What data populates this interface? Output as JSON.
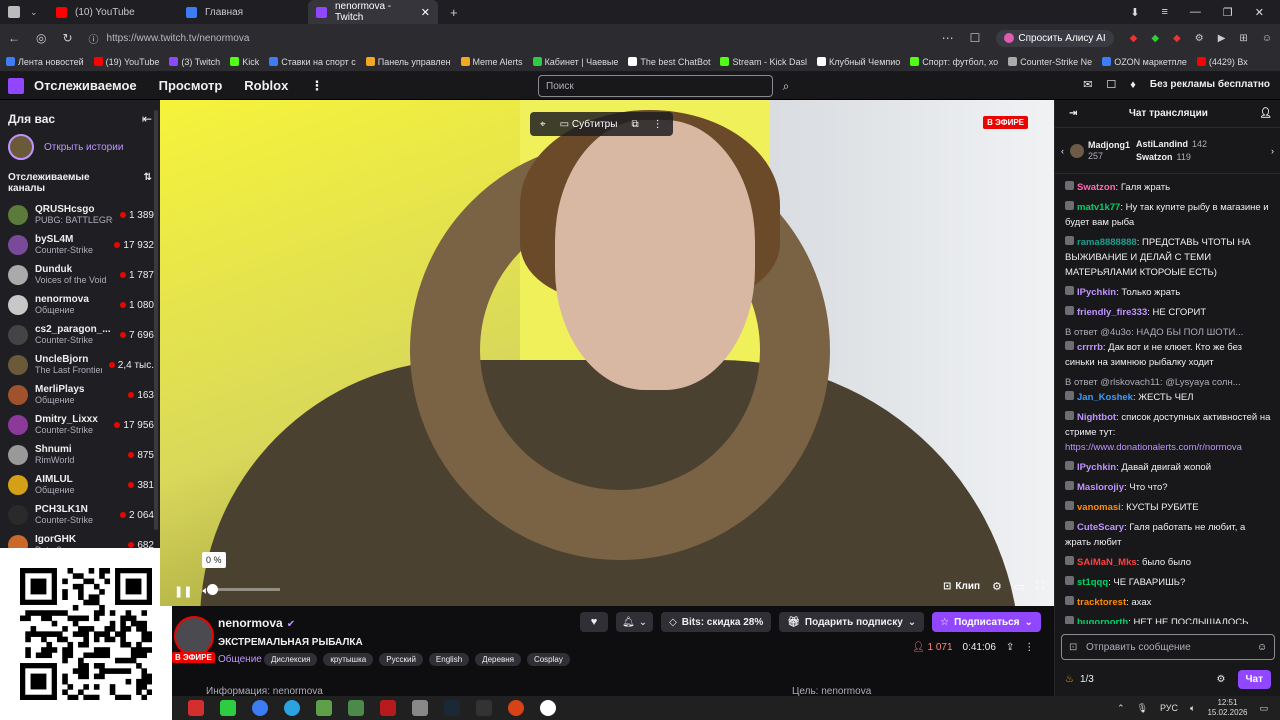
{
  "browser": {
    "tabs": [
      {
        "label": "(10) YouTube",
        "color": "#ff0000"
      },
      {
        "label": "Главная",
        "color": "#3d7cf5"
      },
      {
        "label": "nenormova - Twitch",
        "color": "#9147ff",
        "active": true
      }
    ],
    "url": "https://www.twitch.tv/nenormova",
    "ask_alice": "Спросить Алису AI"
  },
  "bookmarks": [
    {
      "label": "Лента новостей",
      "color": "#3d7cf5"
    },
    {
      "label": "(19) YouTube",
      "color": "#ff0000"
    },
    {
      "label": "(3) Twitch",
      "color": "#9147ff"
    },
    {
      "label": "Kick",
      "color": "#53fc18"
    },
    {
      "label": "Ставки на спорт с",
      "color": "#3d7cf5"
    },
    {
      "label": "Панель управлен",
      "color": "#f5a623"
    },
    {
      "label": "Meme Alerts",
      "color": "#f5a623"
    },
    {
      "label": "Кабинет | Чаевые",
      "color": "#2ecc40"
    },
    {
      "label": "The best ChatBot",
      "color": "#ffffff"
    },
    {
      "label": "Stream - Kick Dasl",
      "color": "#53fc18"
    },
    {
      "label": "Клубный Чемпио",
      "color": "#ffffff"
    },
    {
      "label": "Спорт: футбол, хо",
      "color": "#53fc18"
    },
    {
      "label": "Counter-Strike Ne",
      "color": "#aaaaaa"
    },
    {
      "label": "OZON маркетпле",
      "color": "#3d7cf5"
    },
    {
      "label": "(4429) Вх",
      "color": "#ff0000"
    }
  ],
  "nav": {
    "following": "Отслеживаемое",
    "browse": "Просмотр",
    "roblox": "Roblox",
    "more": "⋮",
    "search_placeholder": "Поиск",
    "no_ads": "Без рекламы бесплатно"
  },
  "sidebar": {
    "for_you": "Для вас",
    "open_stories": "Открыть истории",
    "followed_title": "Отслеживаемые каналы",
    "channels": [
      {
        "name": "QRUSHcsgo",
        "game": "PUBG: BATTLEGROUNDS",
        "viewers": "1 389",
        "color": "#5c7a3a"
      },
      {
        "name": "bySL4M",
        "game": "Counter-Strike",
        "viewers": "17 932",
        "color": "#7a4a9a"
      },
      {
        "name": "Dunduk",
        "game": "Voices of the Void",
        "viewers": "1 787",
        "color": "#aaaaaa"
      },
      {
        "name": "nenormova",
        "game": "Общение",
        "viewers": "1 080",
        "color": "#c8c8c8"
      },
      {
        "name": "cs2_paragon_...",
        "game": "Counter-Strike",
        "viewers": "7 696",
        "color": "#444444"
      },
      {
        "name": "UncleBjorn",
        "game": "The Last Frontier",
        "viewers": "2,4 тыс.",
        "color": "#6b5a3a"
      },
      {
        "name": "MerliPlays",
        "game": "Общение",
        "viewers": "163",
        "color": "#a0522d"
      },
      {
        "name": "Dmitry_Lixxx",
        "game": "Counter-Strike",
        "viewers": "17 956",
        "color": "#8b3a9a"
      },
      {
        "name": "Shnumi",
        "game": "RimWorld",
        "viewers": "875",
        "color": "#999999"
      },
      {
        "name": "AIMLUL",
        "game": "Общение",
        "viewers": "381",
        "color": "#d4a017"
      },
      {
        "name": "PCH3LK1N",
        "game": "Counter-Strike",
        "viewers": "2 064",
        "color": "#2a2a2a"
      },
      {
        "name": "IgorGHK",
        "game": "Dota 2",
        "viewers": "682",
        "color": "#c96a2a"
      }
    ]
  },
  "video": {
    "live_badge": "В ЭФИРЕ",
    "subtitles": "Субтитры",
    "volume_tip": "0 %",
    "volume_level": 0,
    "clip": "Клип"
  },
  "channel": {
    "name": "nenormova",
    "live": "В ЭФИРЕ",
    "title": "ЭКСТРЕМАЛЬНАЯ РЫБАЛКА",
    "category": "Общение",
    "tags": [
      "Дислексия",
      "крутышка",
      "Русский",
      "English",
      "Деревня",
      "Cosplay"
    ],
    "bits": "Bits: скидка 28%",
    "gift_sub": "Подарить подписку",
    "subscribe": "Подписаться",
    "viewers": "1 071",
    "uptime": "0:41:06",
    "info_label": "Информация: nenormova",
    "goal_label": "Цель: nenormova"
  },
  "chat": {
    "title": "Чат трансляции",
    "leaderboard": [
      {
        "name": "Madjong1",
        "count": "257"
      },
      {
        "name": "AstiLandind",
        "count": "142"
      },
      {
        "name": "Swatzon",
        "count": "119"
      }
    ],
    "messages": [
      {
        "user": "Swatzon",
        "color": "#ff69b4",
        "text": "Галя жрать"
      },
      {
        "user": "matv1k77",
        "color": "#00d26a",
        "text": "Ну так купите рыбу в магазине и будет вам рыба"
      },
      {
        "user": "rama8888888",
        "color": "#1e9e8e",
        "text": "ПРЕДСТАВЬ ЧТОТЫ НА ВЫЖИВАНИЕ И ДЕЛАЙ С ТЕМИ МАТЕРЬЯЛАМИ КТОРОЫЕ ЕСТЬ)"
      },
      {
        "user": "IPychkin",
        "color": "#bf94ff",
        "text": "Только жрать"
      },
      {
        "user": "friendly_fire333",
        "color": "#bf94ff",
        "text": "НЕ СГОРИТ"
      },
      {
        "reply": "В ответ @4u3o: НАДО БЫ ПОЛ ШОТИ...",
        "user": "crrrrb",
        "color": "#bf94ff",
        "text": "Дак вот и не клюет. Кто же без синьки на зимнюю рыбалку ходит"
      },
      {
        "reply": "В ответ @rlskovach11: @Lysyaya солн...",
        "user": "Jan_Koshek",
        "color": "#3d9bff",
        "text": "ЖЕСТЬ ЧЕЛ"
      },
      {
        "user": "Nightbot",
        "color": "#bf94ff",
        "text": "список доступных активностей на стриме тут: ",
        "link": "https://www.donationalerts.com/r/normova"
      },
      {
        "user": "IPychkin",
        "color": "#bf94ff",
        "text": "Давай двигай жопой"
      },
      {
        "user": "Maslorojiy",
        "color": "#bf94ff",
        "text": "Что что?"
      },
      {
        "user": "vanomasi",
        "color": "#ff8c00",
        "text": "КУСТЫ РУБИТЕ"
      },
      {
        "user": "CuteScary",
        "color": "#bf94ff",
        "text": "Галя работать не любит, а жрать любит"
      },
      {
        "user": "SAiMaN_Mks",
        "color": "#ff4040",
        "text": "было было"
      },
      {
        "user": "st1qqq",
        "color": "#00d26a",
        "text": "ЧЕ ГАВАРИШЬ?"
      },
      {
        "user": "tracktorest",
        "color": "#ff8c00",
        "text": "ахах"
      },
      {
        "user": "bugornorth",
        "color": "#00d26a",
        "text": "НЕТ НЕ ПОСЛЫШАЛОСЬ"
      }
    ],
    "input_placeholder": "Отправить сообщение",
    "points": "1/3",
    "send": "Чат"
  },
  "taskbar": {
    "lang": "РУС",
    "time": "12:51",
    "date": "15.02.2026"
  }
}
